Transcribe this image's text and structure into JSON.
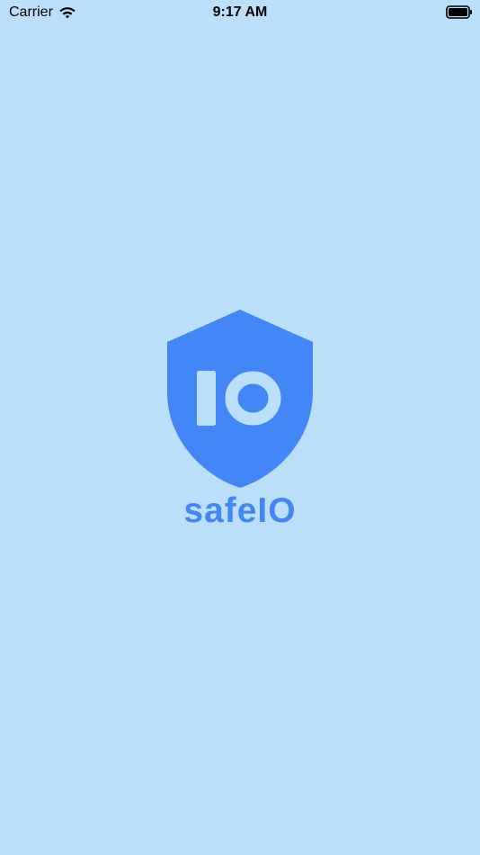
{
  "status_bar": {
    "carrier": "Carrier",
    "time": "9:17 AM",
    "wifi_icon": "wifi-icon",
    "battery_icon": "battery-icon"
  },
  "splash": {
    "logo_icon": "shield-icon",
    "logo_text": "IO",
    "brand_name": "safeIO"
  },
  "colors": {
    "background": "#bcdff9",
    "brand": "#4287f5",
    "status_text": "#000000"
  }
}
